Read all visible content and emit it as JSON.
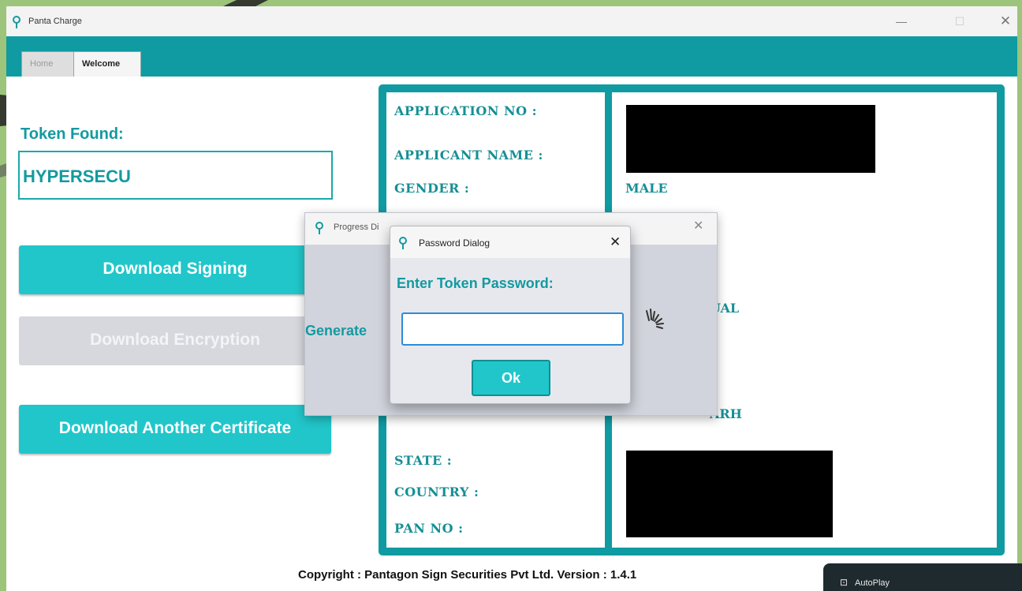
{
  "window": {
    "title": "Panta Charge",
    "controls": {
      "minimize": "—",
      "maximize": "☐",
      "close": "✕"
    }
  },
  "tabs": [
    {
      "label": "Home",
      "active": false
    },
    {
      "label": "Welcome",
      "active": true
    }
  ],
  "left": {
    "token_label": "Token Found:",
    "token_value": "HYPERSECU",
    "buttons": {
      "download_signing": "Download Signing",
      "download_encryption": "Download Encryption",
      "download_another": "Download Another Certificate"
    }
  },
  "info": {
    "labels": {
      "application_no": "APPLICATION NO :",
      "applicant_name": "APPLICANT NAME :",
      "gender": "GENDER :",
      "state": "STATE :",
      "country": "COUNTRY :",
      "pan_no": "PAN NO :"
    },
    "values": {
      "gender": "MALE",
      "partial_1": "UAL",
      "partial_2": "ARH"
    }
  },
  "copyright": "Copyright : Pantagon Sign Securities Pvt Ltd.  Version : 1.4.1",
  "progress_dialog": {
    "title": "Progress Di",
    "close": "✕",
    "generate_text": "Generate"
  },
  "password_dialog": {
    "title": "Password Dialog",
    "close": "✕",
    "prompt": "Enter Token Password:",
    "input_value": "",
    "ok_label": "Ok"
  },
  "taskbar_popup": {
    "label": "AutoPlay",
    "icon": "autoplay-icon"
  },
  "colors": {
    "teal": "#0f9ba1",
    "button_teal": "#21c6ca",
    "text_teal": "#139aa0",
    "disabled": "#d7d8de"
  }
}
